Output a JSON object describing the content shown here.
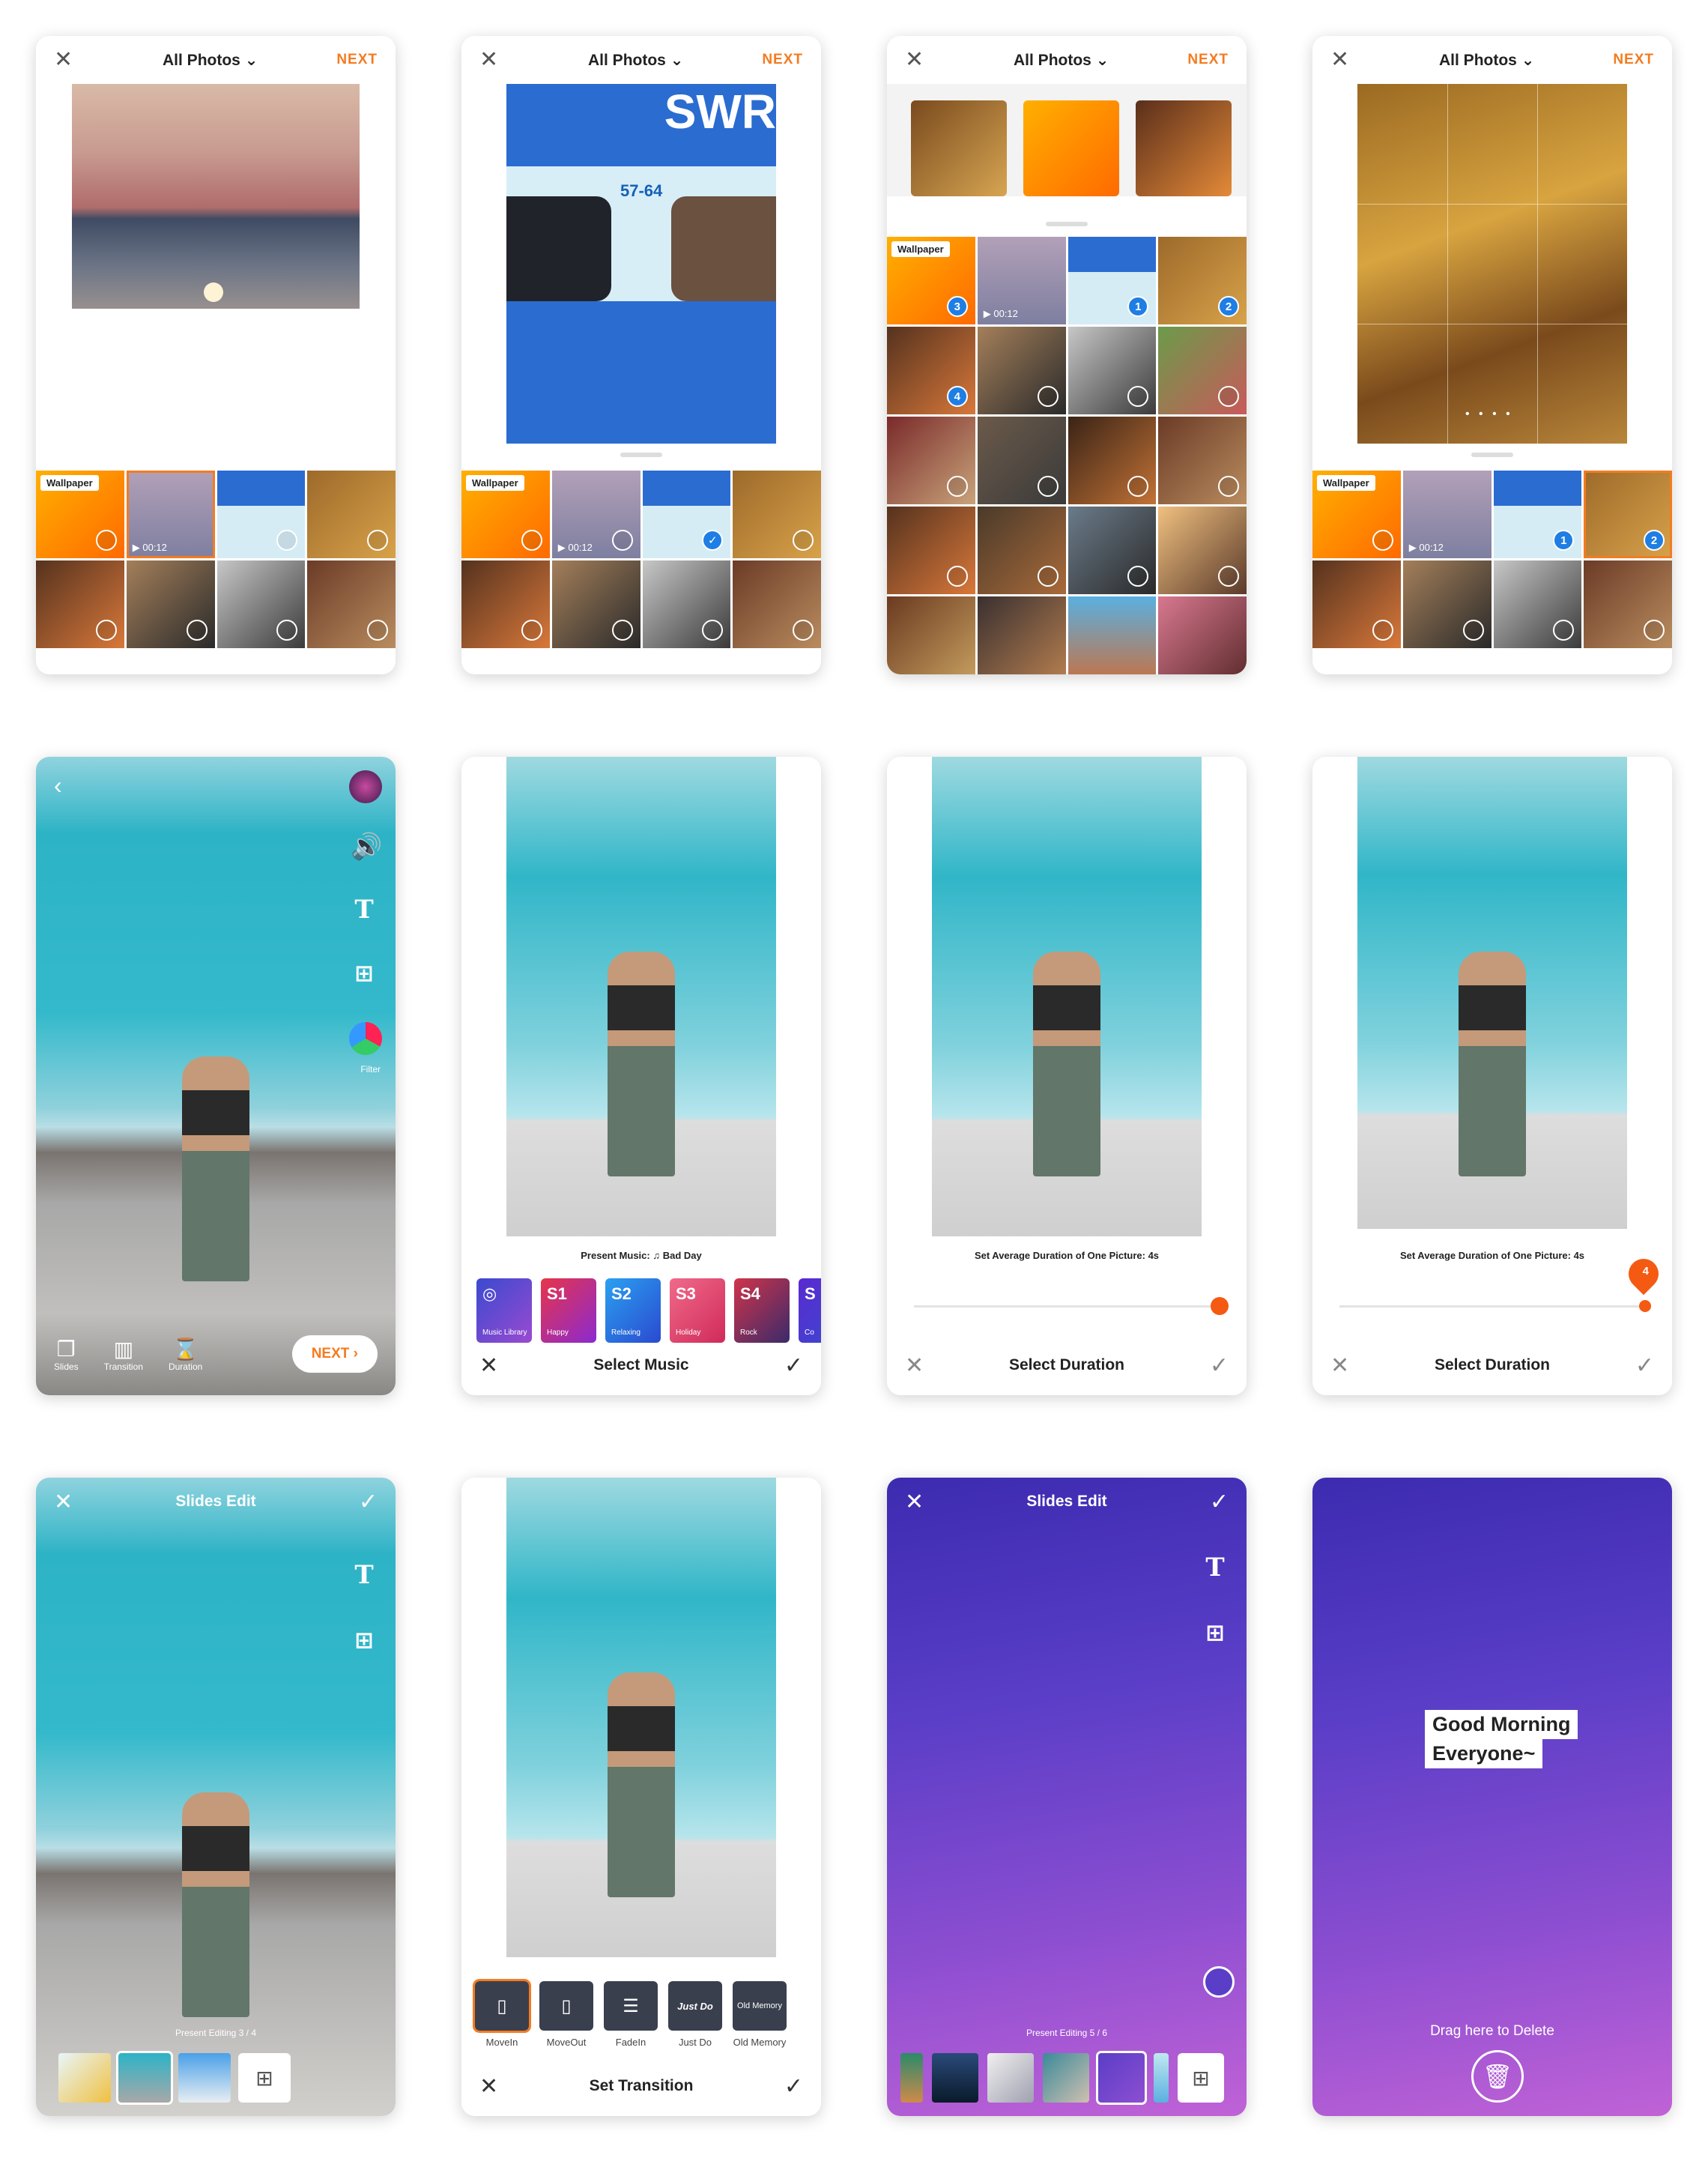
{
  "picker": {
    "title": "All Photos",
    "next": "NEXT",
    "wallpaper_tag": "Wallpaper",
    "video_duration": "00:12",
    "sel1": "1",
    "sel2": "2",
    "sel3": "3",
    "sel4": "4",
    "check": "✓",
    "swr": "SWR",
    "coach_no": "57-64"
  },
  "editor": {
    "next": "NEXT",
    "tools": [
      "Slides",
      "Transition",
      "Duration"
    ],
    "filter": "Filter"
  },
  "music": {
    "present": "Present Music:",
    "song": "Bad Day",
    "tiles": [
      {
        "code": "",
        "name": "Music Library"
      },
      {
        "code": "S1",
        "name": "Happy"
      },
      {
        "code": "S2",
        "name": "Relaxing"
      },
      {
        "code": "S3",
        "name": "Holiday"
      },
      {
        "code": "S4",
        "name": "Rock"
      },
      {
        "code": "S",
        "name": "Co"
      }
    ],
    "title": "Select Music"
  },
  "duration": {
    "label": "Set Average Duration of One Picture: 4s",
    "title": "Select Duration",
    "bubble": "4",
    "value_seconds": 4
  },
  "slides": {
    "title": "Slides Edit",
    "present_1": "Present  Editing 3 / 4",
    "present_2": "Present  Editing 5 / 6"
  },
  "transition": {
    "title": "Set Transition",
    "items": [
      "MoveIn",
      "MoveOut",
      "FadeIn",
      "Just Do",
      "Old Memory"
    ],
    "just_do_text": "Just Do",
    "old_memory_text": "Old Memory"
  },
  "text_slide": {
    "line1": "Good Morning",
    "line2": "Everyone~",
    "delete_hint": "Drag here to Delete"
  },
  "colors": {
    "accent": "#f47b20",
    "select_blue": "#1e7ee4",
    "purple_top": "#3c2bb0",
    "purple_bottom": "#c062d6"
  }
}
